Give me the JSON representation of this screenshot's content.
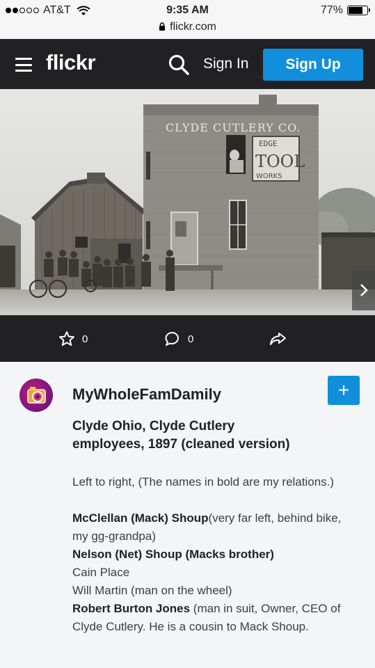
{
  "status_bar": {
    "carrier": "AT&T",
    "time": "9:35 AM",
    "url": "flickr.com",
    "battery": "77%",
    "battery_level": 0.77
  },
  "header": {
    "logo": "flickr",
    "sign_in": "Sign In",
    "sign_up": "Sign Up"
  },
  "photo": {
    "sign_main": "CLYDE CUTLERY CO.",
    "sign_edge": "EDGE",
    "sign_tool": "TOOL",
    "sign_works": "WORKS"
  },
  "actions": {
    "favorites": "0",
    "comments": "0"
  },
  "owner": {
    "name": "MyWholeFamDamily",
    "follow": "+"
  },
  "post": {
    "title": "Clyde Ohio, Clyde Cutlery employees, 1897 (cleaned version)",
    "intro": "Left to right, (The names in bold are my relations.)",
    "lines": [
      {
        "bold": "McClellan (Mack) Shoup",
        "rest": "(very far left, behind bike, my gg-grandpa)"
      },
      {
        "bold": "Nelson (Net) Shoup (Macks brother)",
        "rest": ""
      },
      {
        "bold": "",
        "rest": "Cain Place"
      },
      {
        "bold": "",
        "rest": "Will Martin (man on the wheel)"
      },
      {
        "bold": "Robert Burton Jones",
        "rest": " (man in suit, Owner, CEO of Clyde Cutlery. He is a cousin to Mack Shoup."
      }
    ]
  }
}
